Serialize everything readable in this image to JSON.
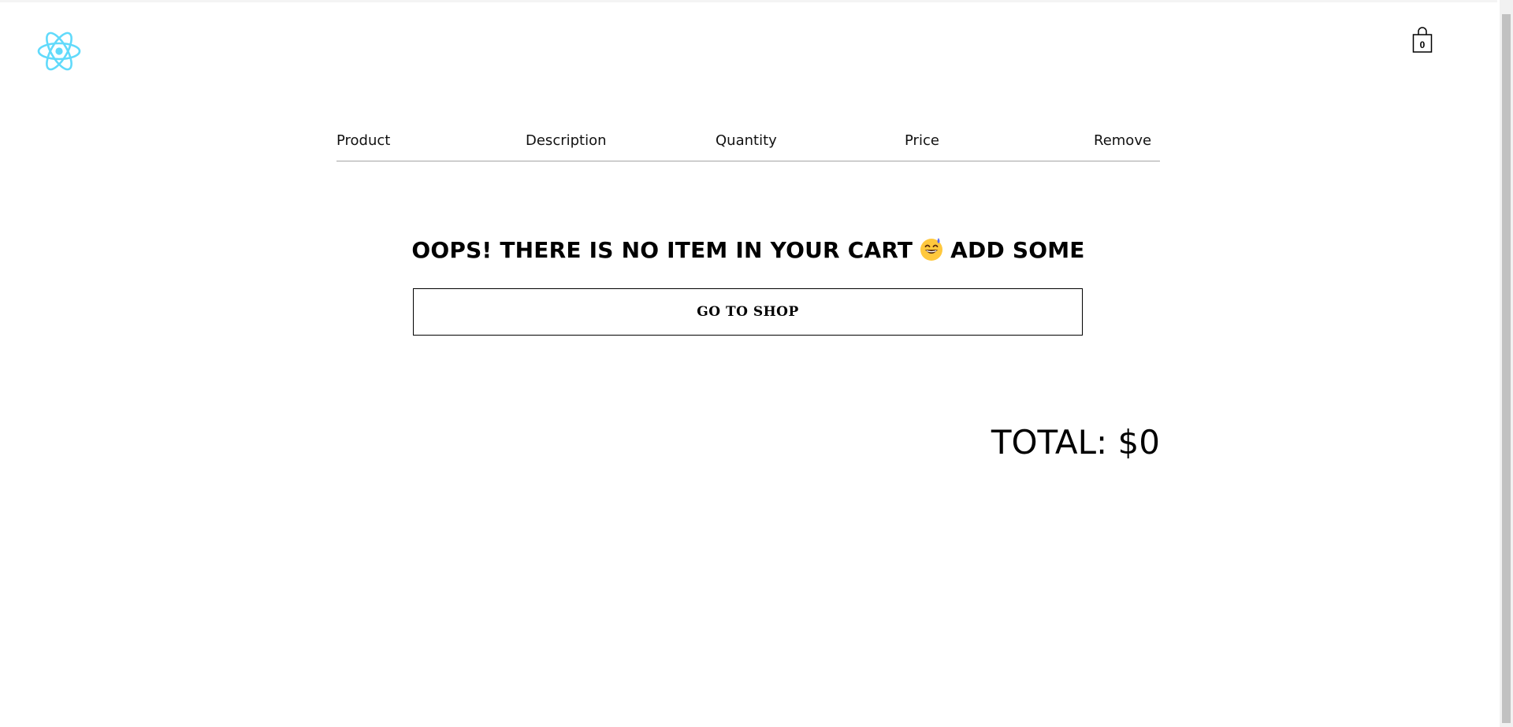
{
  "header": {
    "logo_icon": "react-atom-icon",
    "cart_icon": "shopping-bag-icon",
    "cart_count": "0"
  },
  "cart_table": {
    "columns": [
      "Product",
      "Description",
      "Quantity",
      "Price",
      "Remove"
    ]
  },
  "empty_state": {
    "message_before": "OOPS! THERE IS NO ITEM IN YOUR CART",
    "emoji": "grinning-face-with-sweat-icon",
    "message_after": "ADD SOME",
    "button_label": "GO TO SHOP"
  },
  "summary": {
    "total_label": "TOTAL: $0"
  },
  "colors": {
    "logo": "#61dafb",
    "divider": "#a3a3a3",
    "text": "#000000",
    "background": "#ffffff"
  }
}
